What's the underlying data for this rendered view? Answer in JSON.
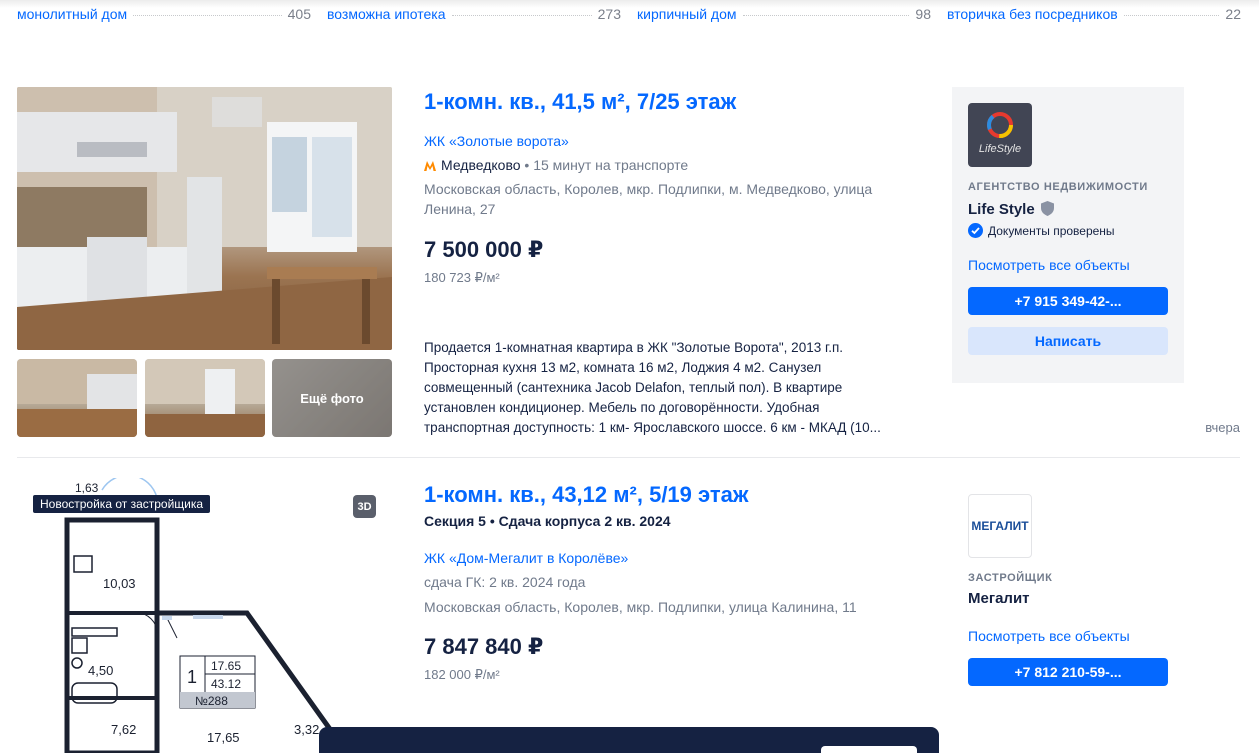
{
  "tags": [
    {
      "label": "монолитный дом",
      "count": "405"
    },
    {
      "label": "возможна ипотека",
      "count": "273"
    },
    {
      "label": "кирпичный дом",
      "count": "98"
    },
    {
      "label": "вторичка без посредников",
      "count": "22"
    }
  ],
  "listing1": {
    "more_photos": "Ещё фото",
    "title": "1-комн. кв., 41,5 м², 7/25 этаж",
    "complex": "ЖК «Золотые ворота»",
    "metro": "Медведково",
    "metro_time": "• 15 минут на транспорте",
    "metro_color": "#ff8a00",
    "address_1": "Московская область, Королев, мкр. Подлипки, м. Медведково, улица",
    "address_2": "Ленина, 27",
    "price": "7 500 000 ₽",
    "price_per_m": "180 723 ₽/м²",
    "description": [
      "Продается 1-комнатная квартира в ЖК \"Золотые Ворота\", 2013 г.п.",
      "Просторная кухня 13 м2, комната 16 м2, Лоджия 4 м2. Санузел",
      "совмещенный (сантехника Jacob Delafon, теплый пол). В квартире",
      "установлен кондиционер. Мебель по договорённости. Удобная",
      "транспортная доступность: 1 км- Ярославского шоссе. 6 км - МКАД (10..."
    ],
    "date": "вчера",
    "agent": {
      "logo_text": "LifeStyle",
      "caption": "АГЕНТСТВО НЕДВИЖИМОСТИ",
      "name": "Life Style",
      "verified": "Документы проверены",
      "all_link": "Посмотреть все объекты",
      "phone": "+7 915 349-42-...",
      "message": "Написать"
    }
  },
  "listing2": {
    "badge": "Новостройка от застройщика",
    "badge_3d": "3D",
    "plan_labels": {
      "dim_top": "1,63",
      "room_a": "10,03",
      "room_b": "4,50",
      "room_c": "7,62",
      "room_d": "17,65",
      "room_e": "3,32",
      "plate_rooms": "1",
      "plate_living": "17.65",
      "plate_total": "43.12",
      "plate_no": "№288"
    },
    "title": "1-комн. кв., 43,12 м², 5/19 этаж",
    "section": "Секция 5 • Сдача корпуса 2 кв. 2024",
    "complex": "ЖК «Дом-Мегалит в Королёве»",
    "deadline": "сдача ГК: 2 кв. 2024 года",
    "address": "Московская область, Королев, мкр. Подлипки, улица Калинина, 11",
    "price": "7 847 840 ₽",
    "price_per_m": "182 000 ₽/м²",
    "builder": {
      "logo_text": "МЕГАЛИТ",
      "caption": "ЗАСТРОЙЩИК",
      "name": "Мегалит",
      "all_link": "Посмотреть все объекты",
      "phone": "+7 812 210-59-..."
    }
  }
}
